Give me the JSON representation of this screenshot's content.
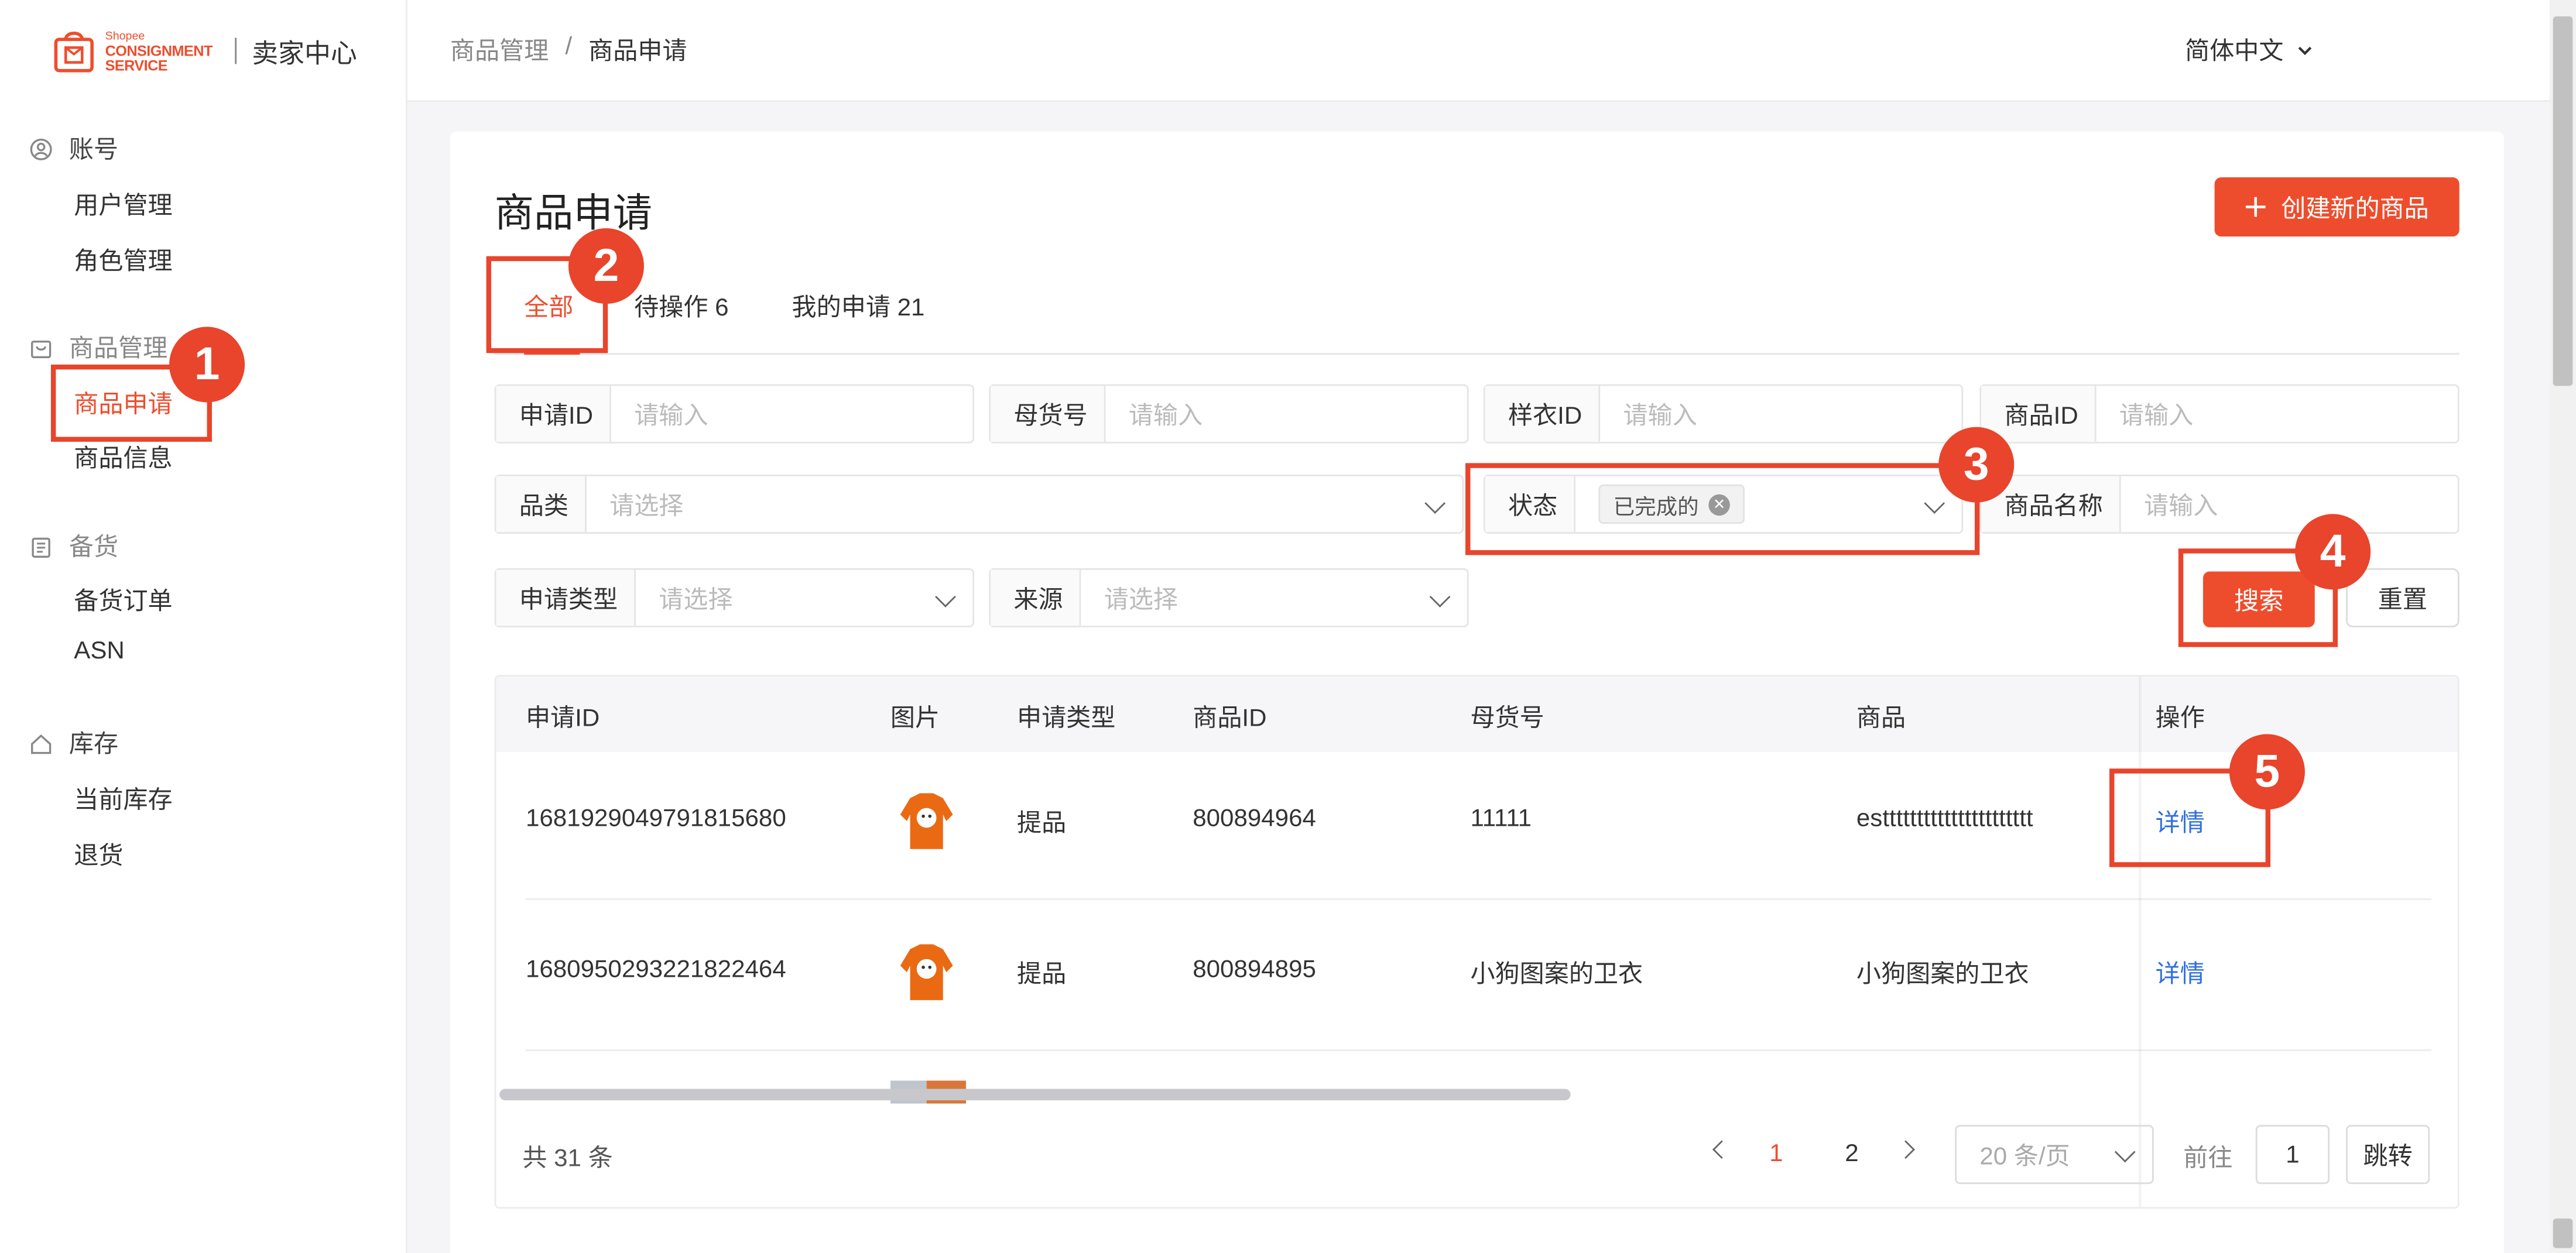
{
  "brand": {
    "logo_small": "Shopee",
    "logo_line1": "CONSIGNMENT",
    "logo_line2": "SERVICE",
    "center": "卖家中心",
    "accent": "#ee4d2d"
  },
  "sidebar": {
    "groups": [
      {
        "title": "账号",
        "icon": "user-circle-icon",
        "items": [
          "用户管理",
          "角色管理"
        ]
      },
      {
        "title": "商品管理",
        "icon": "shopping-bag-icon",
        "items": [
          "商品申请",
          "商品信息"
        ]
      },
      {
        "title": "备货",
        "icon": "clipboard-icon",
        "items": [
          "备货订单",
          "ASN"
        ]
      },
      {
        "title": "库存",
        "icon": "home-icon",
        "items": [
          "当前库存",
          "退货"
        ]
      }
    ],
    "active_item": "商品申请"
  },
  "topbar": {
    "breadcrumb": [
      "商品管理",
      "/",
      "商品申请"
    ],
    "language": "简体中文"
  },
  "page": {
    "title": "商品申请",
    "create_button": "创建新的商品",
    "tabs": [
      "全部",
      "待操作 6",
      "我的申请 21"
    ],
    "active_tab": "全部"
  },
  "filters": {
    "apply_id": {
      "label": "申请ID",
      "placeholder": "请输入"
    },
    "parent_sku": {
      "label": "母货号",
      "placeholder": "请输入"
    },
    "sample_id": {
      "label": "样衣ID",
      "placeholder": "请输入"
    },
    "product_id": {
      "label": "商品ID",
      "placeholder": "请输入"
    },
    "category": {
      "label": "品类",
      "placeholder": "请选择"
    },
    "status": {
      "label": "状态",
      "value": "已完成的"
    },
    "product_name": {
      "label": "商品名称",
      "placeholder": "请输入"
    },
    "apply_type": {
      "label": "申请类型",
      "placeholder": "请选择"
    },
    "source": {
      "label": "来源",
      "placeholder": "请选择"
    },
    "search_button": "搜索",
    "reset_button": "重置"
  },
  "table": {
    "columns": [
      "申请ID",
      "图片",
      "申请类型",
      "商品ID",
      "母货号",
      "商品",
      "操作"
    ],
    "rows": [
      {
        "apply_id": "1681929049791815680",
        "type": "提品",
        "product_id": "800894964",
        "parent_sku": "11111",
        "product": "estttttttttttttttttttttt",
        "action": "详情"
      },
      {
        "apply_id": "1680950293221822464",
        "type": "提品",
        "product_id": "800894895",
        "parent_sku": "小狗图案的卫衣",
        "product": "小狗图案的卫衣",
        "action": "详情"
      }
    ]
  },
  "pagination": {
    "total": "共 31 条",
    "pages": [
      "1",
      "2"
    ],
    "current": "1",
    "page_size": "20 条/页",
    "goto_label": "前往",
    "goto_value": "1",
    "goto_button": "跳转"
  },
  "annotations": [
    "1",
    "2",
    "3",
    "4",
    "5"
  ]
}
